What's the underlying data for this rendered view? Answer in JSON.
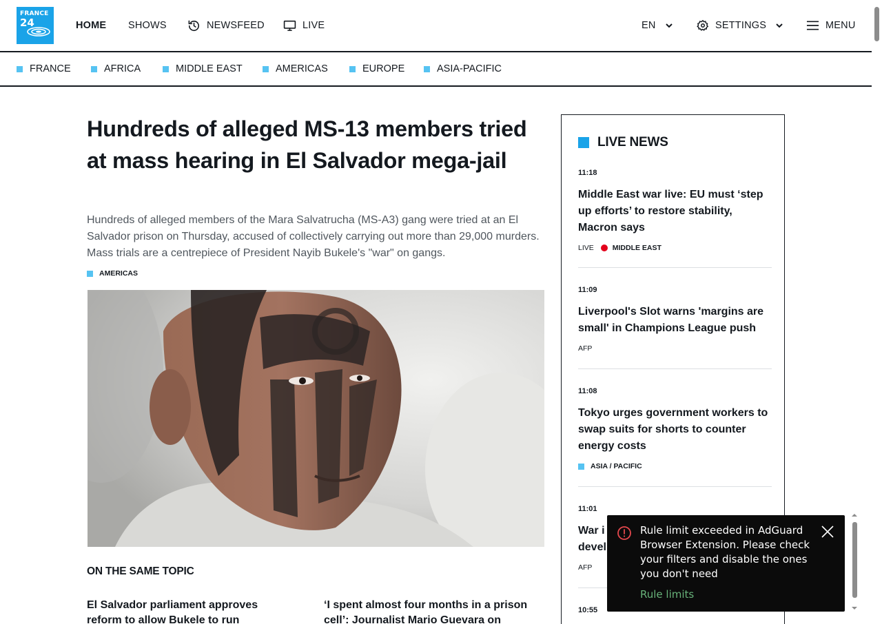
{
  "header": {
    "logo_line1": "FRANCE",
    "logo_line2": "24",
    "nav": {
      "home": "HOME",
      "shows": "SHOWS",
      "newsfeed": "NEWSFEED",
      "live": "LIVE",
      "language": "EN",
      "settings": "SETTINGS",
      "menu": "MENU"
    }
  },
  "regions": [
    "FRANCE",
    "AFRICA",
    "MIDDLE EAST",
    "AMERICAS",
    "EUROPE",
    "ASIA-PACIFIC"
  ],
  "article": {
    "headline": "Hundreds of alleged MS-13 members tried at mass hearing in El Salvador mega-jail",
    "lede": "Hundreds of alleged members of the Mara Salvatrucha (MS-A3) gang were tried at an El Salvador prison on Thursday, accused of collectively carrying out more than 29,000 murders. Mass trials are a centrepiece of President Nayib Bukele's \"war\" on gangs.",
    "tag": "AMERICAS",
    "same_topic_heading": "ON THE SAME TOPIC",
    "related": [
      "El Salvador parliament approves reform to allow Bukele to run indefinitely",
      "‘I spent almost four months in a prison cell’: Journalist Mario Guevara on"
    ]
  },
  "live_news": {
    "title": "LIVE NEWS",
    "items": [
      {
        "time": "11:18",
        "title": "Middle East war live: EU must ‘step up efforts’ to restore stability, Macron says",
        "label": "LIVE",
        "tag": "MIDDLE EAST"
      },
      {
        "time": "11:09",
        "title": "Liverpool's Slot warns 'margins are small' in Champions League push",
        "label": "AFP"
      },
      {
        "time": "11:08",
        "title": "Tokyo urges government workers to swap suits for shorts to counter energy costs",
        "tag": "ASIA / PACIFIC"
      },
      {
        "time": "11:01",
        "title": "War i",
        "title2": "devel",
        "label": "AFP"
      },
      {
        "time": "10:55"
      }
    ]
  },
  "toast": {
    "message": "Rule limit exceeded in AdGuard Browser Extension. Please check your filters and disable the ones you don't need",
    "link": "Rule limits"
  },
  "colors": {
    "accent": "#1aa3e8",
    "tag_square": "#56c3f2",
    "live_dot": "#e3001b",
    "toast_bg": "#0b0b0b",
    "toast_link": "#67b279"
  }
}
